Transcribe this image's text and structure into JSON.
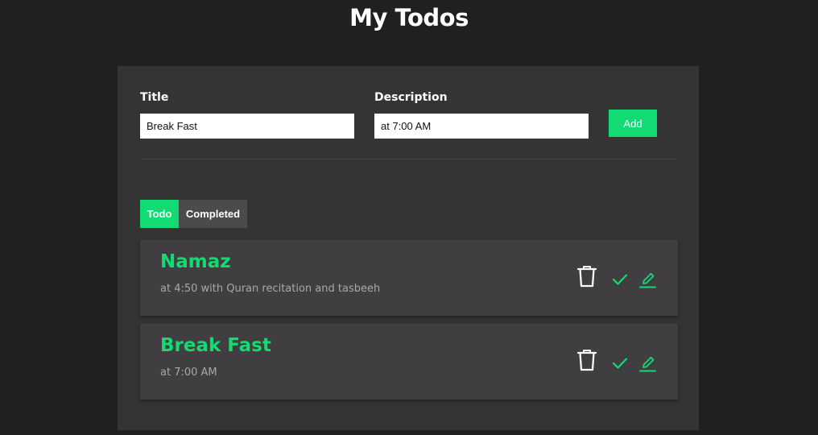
{
  "header": {
    "title": "My Todos"
  },
  "form": {
    "title_label": "Title",
    "title_value": "Break Fast",
    "description_label": "Description",
    "description_value": "at 7:00 AM",
    "add_label": "Add"
  },
  "tabs": {
    "todo_label": "Todo",
    "completed_label": "Completed",
    "active": "Todo"
  },
  "todos": [
    {
      "title": "Namaz",
      "description": "at 4:50 with Quran recitation and tasbeeh",
      "actions": [
        "trash-icon",
        "check-icon",
        "edit-icon"
      ]
    },
    {
      "title": "Break Fast",
      "description": "at 7:00 AM",
      "actions": [
        "trash-icon",
        "check-icon",
        "edit-icon"
      ]
    }
  ],
  "colors": {
    "background": "#211f20",
    "panel": "#353435",
    "card": "#403e40",
    "accent": "#12db74"
  }
}
